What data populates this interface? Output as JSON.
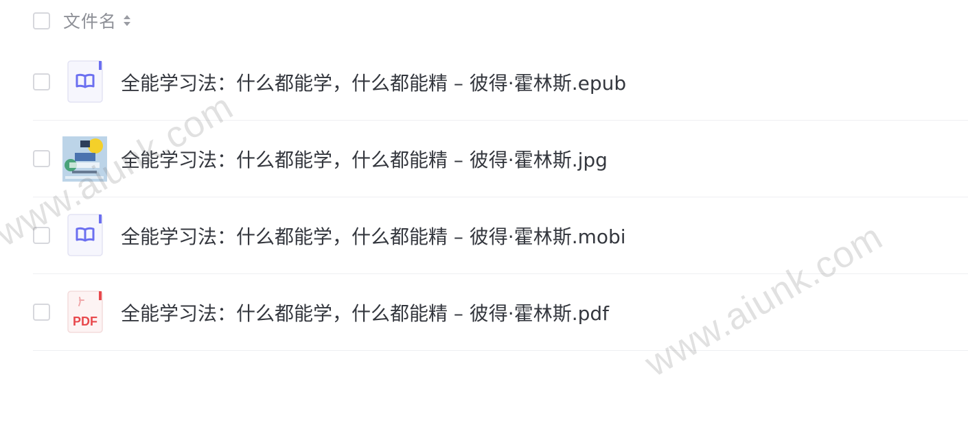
{
  "header": {
    "column_label": "文件名",
    "sort_icon": "sort-updown-icon"
  },
  "files": [
    {
      "name": "全能学习法：什么都能学，什么都能精 – 彼得·霍林斯.epub",
      "type": "epub",
      "icon": "ebook-icon"
    },
    {
      "name": "全能学习法：什么都能学，什么都能精 – 彼得·霍林斯.jpg",
      "type": "jpg",
      "icon": "image-thumbnail"
    },
    {
      "name": "全能学习法：什么都能学，什么都能精 – 彼得·霍林斯.mobi",
      "type": "mobi",
      "icon": "ebook-icon"
    },
    {
      "name": "全能学习法：什么都能学，什么都能精 – 彼得·霍林斯.pdf",
      "type": "pdf",
      "icon": "pdf-icon",
      "icon_text": "PDF"
    }
  ],
  "watermark": {
    "text": "www.aiunk.com"
  },
  "colors": {
    "ebook_accent": "#6b6ff0",
    "pdf_accent": "#e8484c",
    "checkbox_border": "#d6d7dc",
    "divider": "#eeeff2"
  }
}
